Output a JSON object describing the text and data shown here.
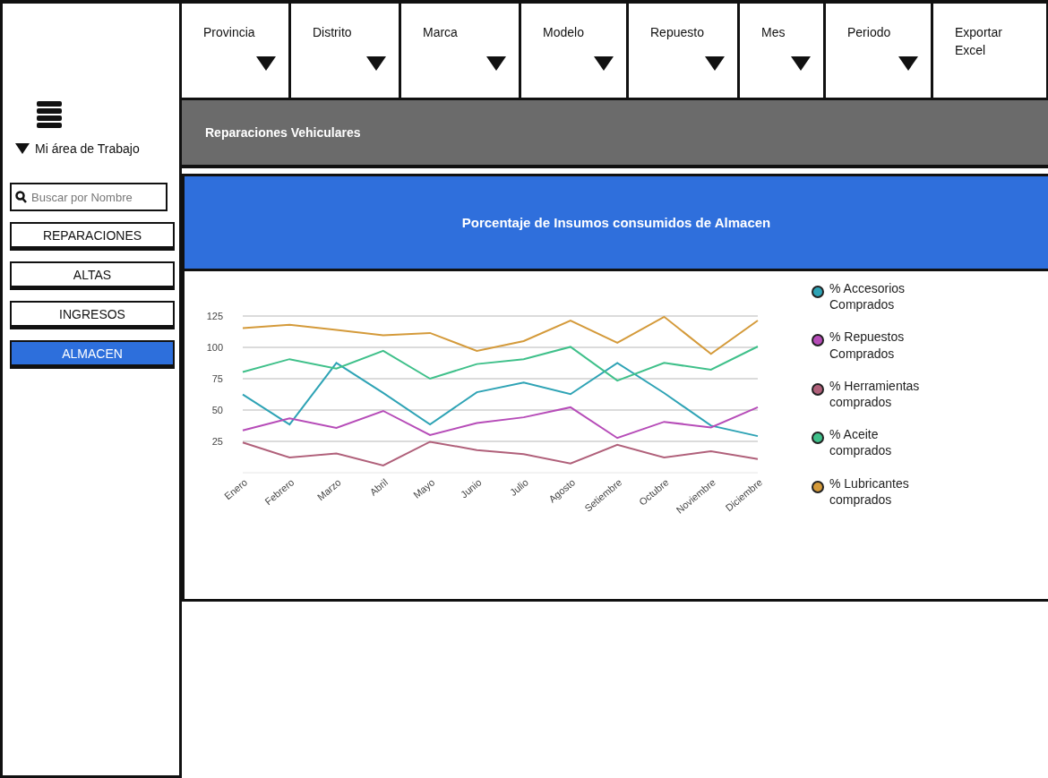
{
  "sidebar": {
    "workspace": "Mi área de Trabajo",
    "search": {
      "placeholder": "Buscar por Nombre"
    },
    "items": [
      {
        "label": "REPARACIONES",
        "selected": false
      },
      {
        "label": "ALTAS",
        "selected": false
      },
      {
        "label": "INGRESOS",
        "selected": false
      },
      {
        "label": "ALMACEN",
        "selected": true
      }
    ]
  },
  "filters": [
    {
      "label": "Provincia",
      "kind": "dropdown"
    },
    {
      "label": "Distrito",
      "kind": "dropdown"
    },
    {
      "label": "Marca",
      "kind": "dropdown"
    },
    {
      "label": "Modelo",
      "kind": "dropdown"
    },
    {
      "label": "Repuesto",
      "kind": "dropdown"
    },
    {
      "label": "Mes",
      "kind": "dropdown"
    },
    {
      "label": "Periodo",
      "kind": "dropdown"
    },
    {
      "label": "Exportar Excel",
      "kind": "button"
    }
  ],
  "section_title": "Reparaciones Vehiculares",
  "panel": {
    "title": "Porcentaje de Insumos consumidos de Almacen",
    "chart_data": {
      "type": "line",
      "categories": [
        "Enero",
        "Febrero",
        "Marzo",
        "Abril",
        "Mayo",
        "Junio",
        "Julio",
        "Agosto",
        "Setiembre",
        "Octubre",
        "Noviembre",
        "Diciembre"
      ],
      "yticks": [
        25,
        50,
        75,
        100,
        125
      ],
      "ylim": [
        0,
        125
      ],
      "grid": true,
      "series": [
        {
          "name": "% Accesorios Comprados",
          "color": "#2ea3b5",
          "values": [
            62.4,
            38.5,
            87.6,
            63.6,
            38.5,
            64.2,
            72,
            62.7,
            87.6,
            63.6,
            37.6,
            29.2
          ]
        },
        {
          "name": "% Repuestos Comprados",
          "color": "#b64cb8",
          "values": [
            33.7,
            43.3,
            35.8,
            49.3,
            30.1,
            39.7,
            44.2,
            52.2,
            27.7,
            40.6,
            36.1,
            52.2
          ]
        },
        {
          "name": "% Herramientas comprados",
          "color": "#b0607a",
          "values": [
            24.1,
            12.1,
            15.4,
            5.8,
            24.7,
            18.1,
            14.8,
            7.3,
            22.3,
            12.1,
            17.2,
            10.9
          ]
        },
        {
          "name": "% Aceite comprados",
          "color": "#3fc08a",
          "values": [
            80.4,
            90.6,
            83.1,
            97.2,
            75,
            86.7,
            90.6,
            100.4,
            73.5,
            87.6,
            82.2,
            100.7
          ]
        },
        {
          "name": "% Lubricantes comprados",
          "color": "#d49a3a",
          "values": [
            115.4,
            118.1,
            113.9,
            109.7,
            111.5,
            97.2,
            105,
            121.4,
            103.7,
            124.4,
            94.8,
            121.4
          ]
        }
      ]
    }
  }
}
